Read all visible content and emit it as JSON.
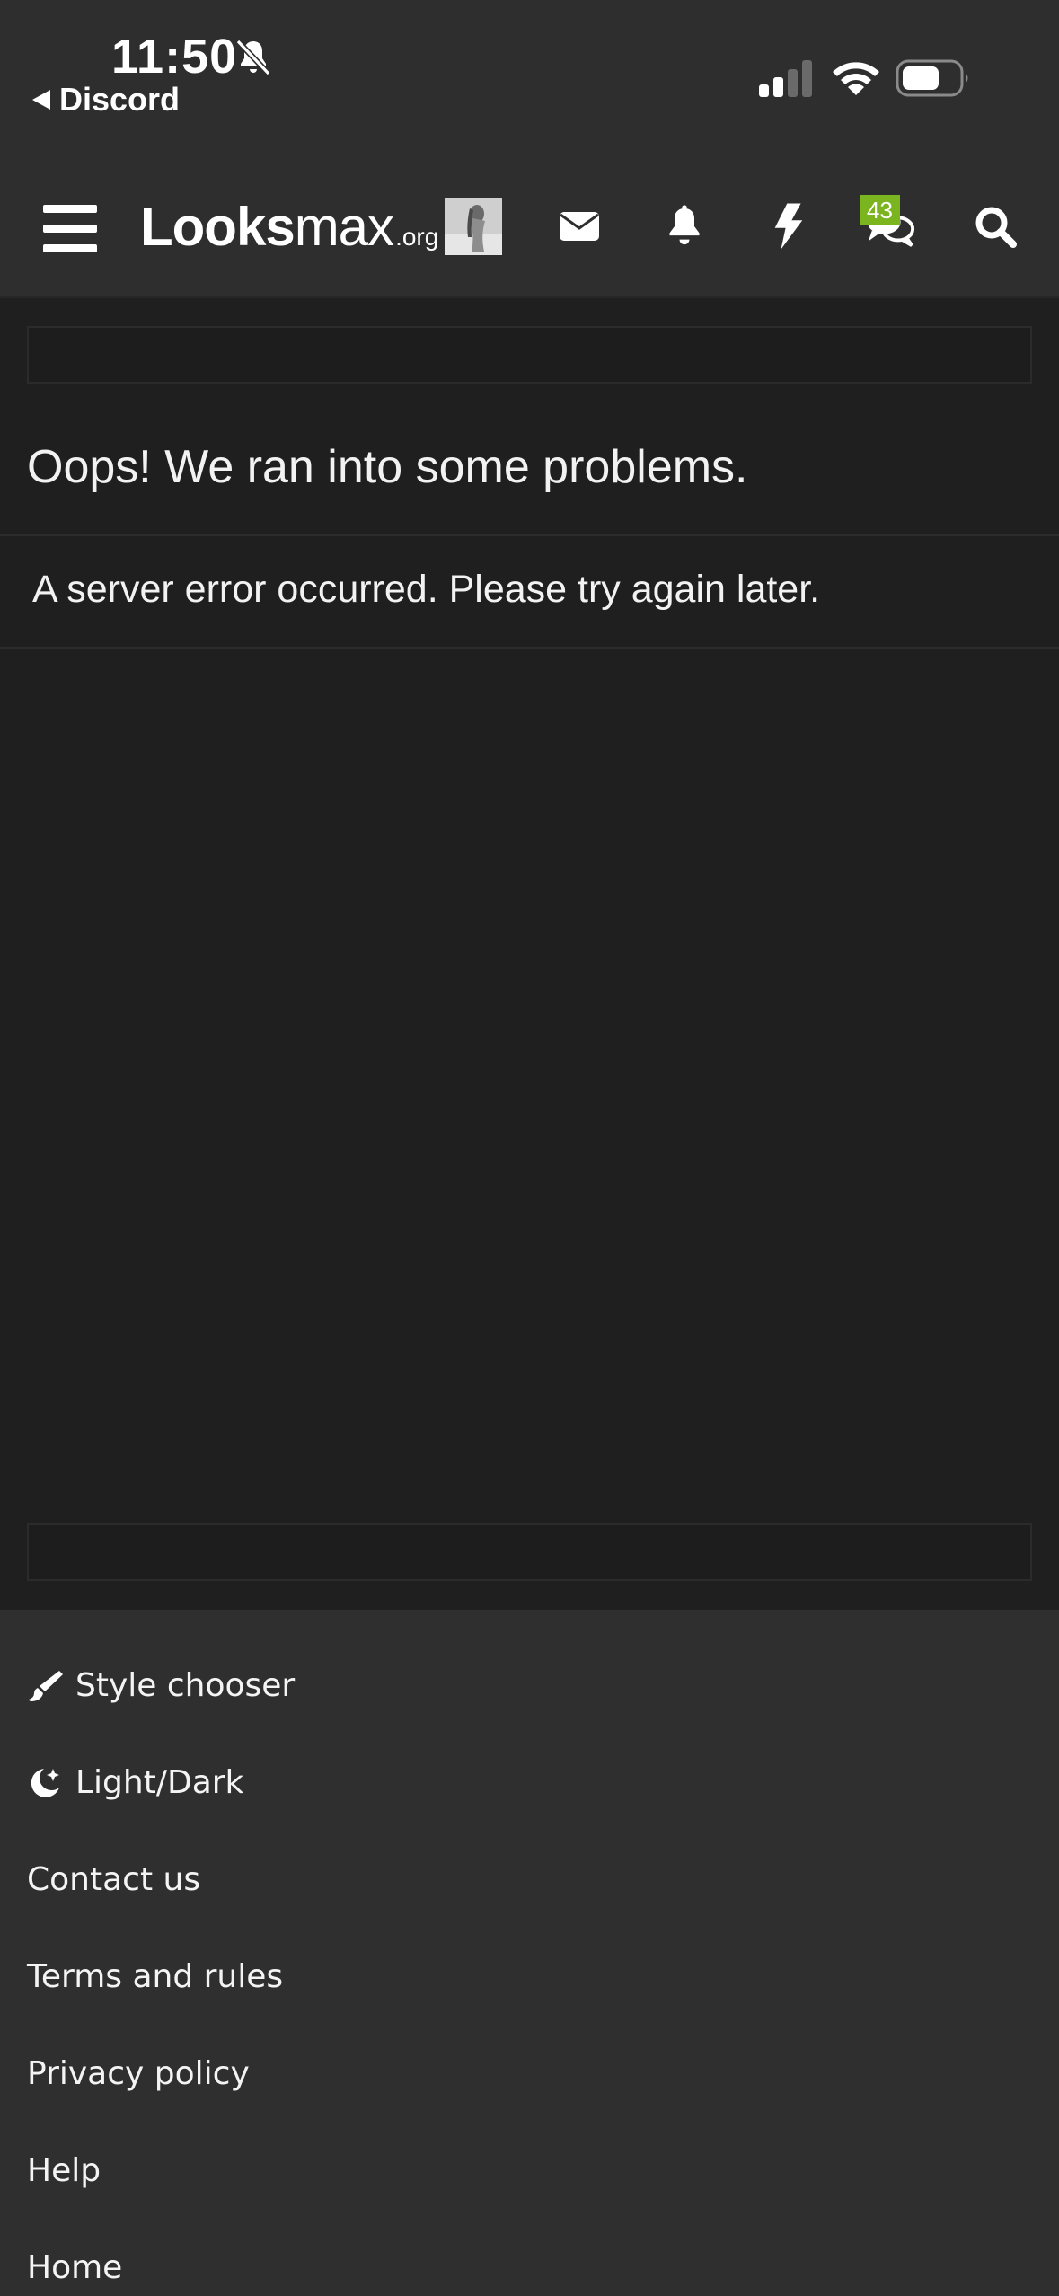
{
  "status_bar": {
    "time": "11:50",
    "back_label": "Discord",
    "icons": [
      "bell-slash-icon",
      "signal-icon",
      "wifi-icon",
      "battery-icon"
    ]
  },
  "navbar": {
    "logo_part1": "Looks",
    "logo_part2": "max",
    "logo_tld": ".org",
    "chat_badge": "43",
    "icons": [
      "menu-icon",
      "avatar",
      "envelope-icon",
      "bell-icon",
      "bolt-icon",
      "chat-icon",
      "search-icon"
    ]
  },
  "main": {
    "error_title": "Oops! We ran into some problems.",
    "error_message": "A server error occurred. Please try again later."
  },
  "footer": {
    "links": [
      {
        "label": "Style chooser",
        "icon": "paintbrush-icon"
      },
      {
        "label": "Light/Dark",
        "icon": "moon-icon"
      },
      {
        "label": "Contact us"
      },
      {
        "label": "Terms and rules"
      },
      {
        "label": "Privacy policy"
      },
      {
        "label": "Help"
      },
      {
        "label": "Home"
      }
    ]
  },
  "colors": {
    "background": "#1f1f1f",
    "bar": "#2e2e2e",
    "footer": "#2f2f2f",
    "badge": "#7ab41f"
  }
}
